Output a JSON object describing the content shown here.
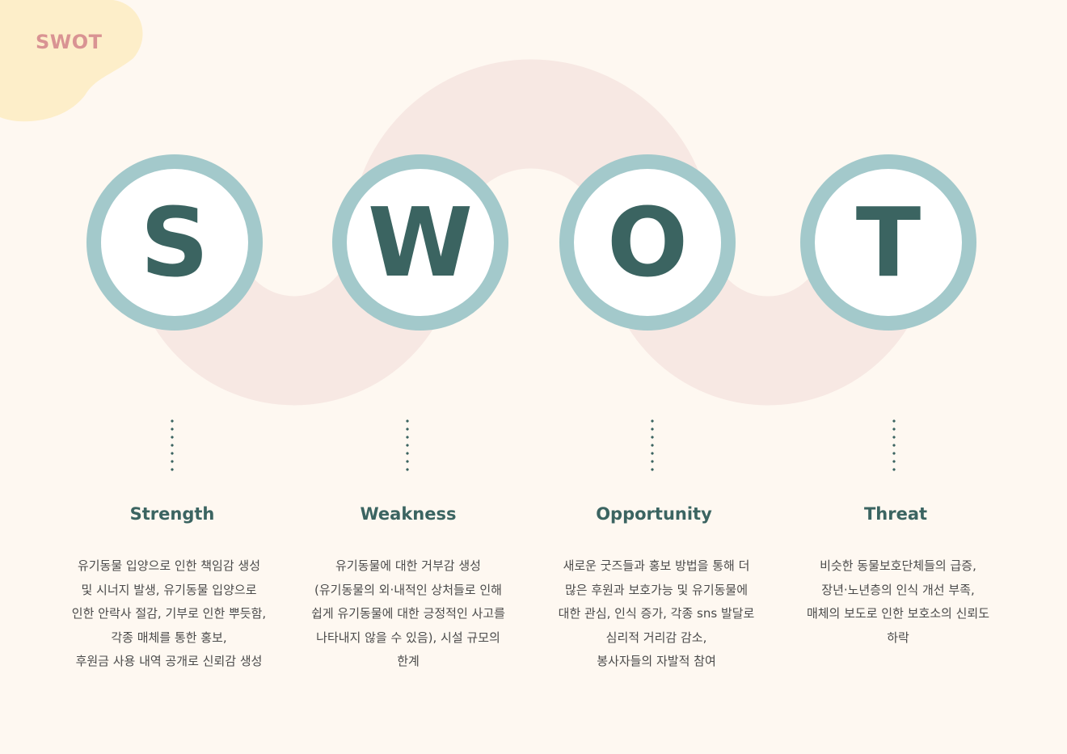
{
  "corner_tag": "SWOT",
  "colors": {
    "background": "#fef8f1",
    "blob": "#fdeec9",
    "band": "#f7e8e3",
    "ring": "#a3c9cb",
    "letter": "#3b6461",
    "tag": "#d99393",
    "text": "#4a4a4a"
  },
  "items": [
    {
      "letter": "S",
      "title": "Strength",
      "lines": [
        "유기동물 입양으로 인한  책임감 생성",
        "및 시너지 발생, 유기동물 입양으로",
        "인한 안락사 절감, 기부로 인한 뿌듯함,",
        "각종 매체를 통한 홍보,",
        "후원금 사용 내역 공개로 신뢰감 생성"
      ]
    },
    {
      "letter": "W",
      "title": "Weakness",
      "lines": [
        "유기동물에 대한 거부감 생성",
        "(유기동물의 외·내적인 상처들로 인해",
        "쉽게 유기동물에 대한 긍정적인 사고를",
        "나타내지 않을 수 있음), 시설 규모의",
        "한계"
      ]
    },
    {
      "letter": "O",
      "title": "Opportunity",
      "lines": [
        "새로운 굿즈들과 홍보 방법을 통해 더",
        "많은 후원과 보호가능 및 유기동물에",
        "대한 관심, 인식 증가, 각종 sns 발달로",
        "심리적 거리감 감소,",
        "봉사자들의 자발적 참여"
      ]
    },
    {
      "letter": "T",
      "title": "Threat",
      "lines": [
        "비슷한 동물보호단체들의 급증,",
        "장년·노년층의 인식 개선 부족,",
        "매체의 보도로 인한 보호소의 신뢰도",
        "하락"
      ]
    }
  ]
}
